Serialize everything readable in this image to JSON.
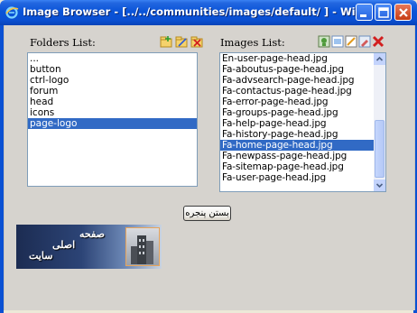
{
  "window": {
    "title": "Image Browser - [../../communities/images/default/ ] - Windows Intern..."
  },
  "folders": {
    "label": "Folders List:",
    "items": [
      {
        "label": "..."
      },
      {
        "label": "button"
      },
      {
        "label": "ctrl-logo"
      },
      {
        "label": "forum"
      },
      {
        "label": "head"
      },
      {
        "label": "icons"
      },
      {
        "label": "page-logo"
      }
    ],
    "selected_index": 6,
    "tools": [
      "new-folder-icon",
      "rename-folder-icon",
      "delete-folder-icon"
    ]
  },
  "images": {
    "label": "Images List:",
    "items": [
      {
        "label": "En-user-page-head.jpg"
      },
      {
        "label": "Fa-aboutus-page-head.jpg"
      },
      {
        "label": "Fa-advsearch-page-head.jpg"
      },
      {
        "label": "Fa-contactus-page-head.jpg"
      },
      {
        "label": "Fa-error-page-head.jpg"
      },
      {
        "label": "Fa-groups-page-head.jpg"
      },
      {
        "label": "Fa-help-page-head.jpg"
      },
      {
        "label": "Fa-history-page-head.jpg"
      },
      {
        "label": "Fa-home-page-head.jpg"
      },
      {
        "label": "Fa-newpass-page-head.jpg"
      },
      {
        "label": "Fa-sitemap-page-head.jpg"
      },
      {
        "label": "Fa-user-page-head.jpg"
      }
    ],
    "selected_index": 8,
    "tools": [
      "upload-image-icon",
      "view-image-icon",
      "rename-image-icon",
      "edit-image-icon",
      "delete-image-icon"
    ]
  },
  "actions": {
    "close_window_label": "بستن پنجره"
  },
  "preview": {
    "line1": "صفحه",
    "line2": "اصلی",
    "line3": "سایت"
  },
  "colors": {
    "titlebar": "#0a54d8",
    "selection": "#316ac5",
    "dialog_bg": "#d6d3ce"
  }
}
